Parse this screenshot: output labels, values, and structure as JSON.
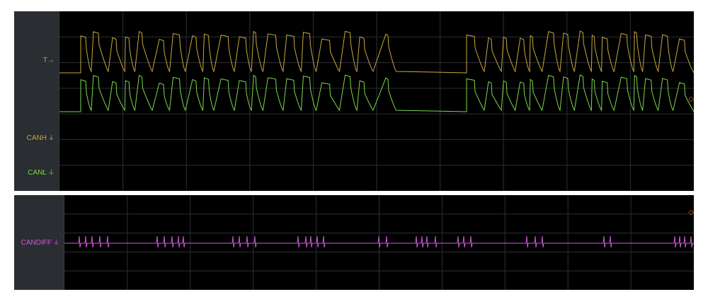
{
  "top_panel": {
    "labels": {
      "trigger": "T→",
      "canh": "CANH",
      "canl": "CANL",
      "ground_glyph": "⏚"
    },
    "colors": {
      "canh": "#c8a83a",
      "canl": "#7bd84a",
      "trigger": "#c8a83a",
      "grid": "#2b2f35",
      "rail": "#2a2d31"
    }
  },
  "bottom_panel": {
    "labels": {
      "candiff": "CANDIFF",
      "ground_glyph": "⏚"
    },
    "colors": {
      "candiff": "#d05ad8",
      "marker": "#e07a2e",
      "grid": "#2b2f35"
    }
  },
  "icons": [
    "ground-reference-icon",
    "trigger-arrow-icon",
    "offscreen-marker-icon"
  ]
}
